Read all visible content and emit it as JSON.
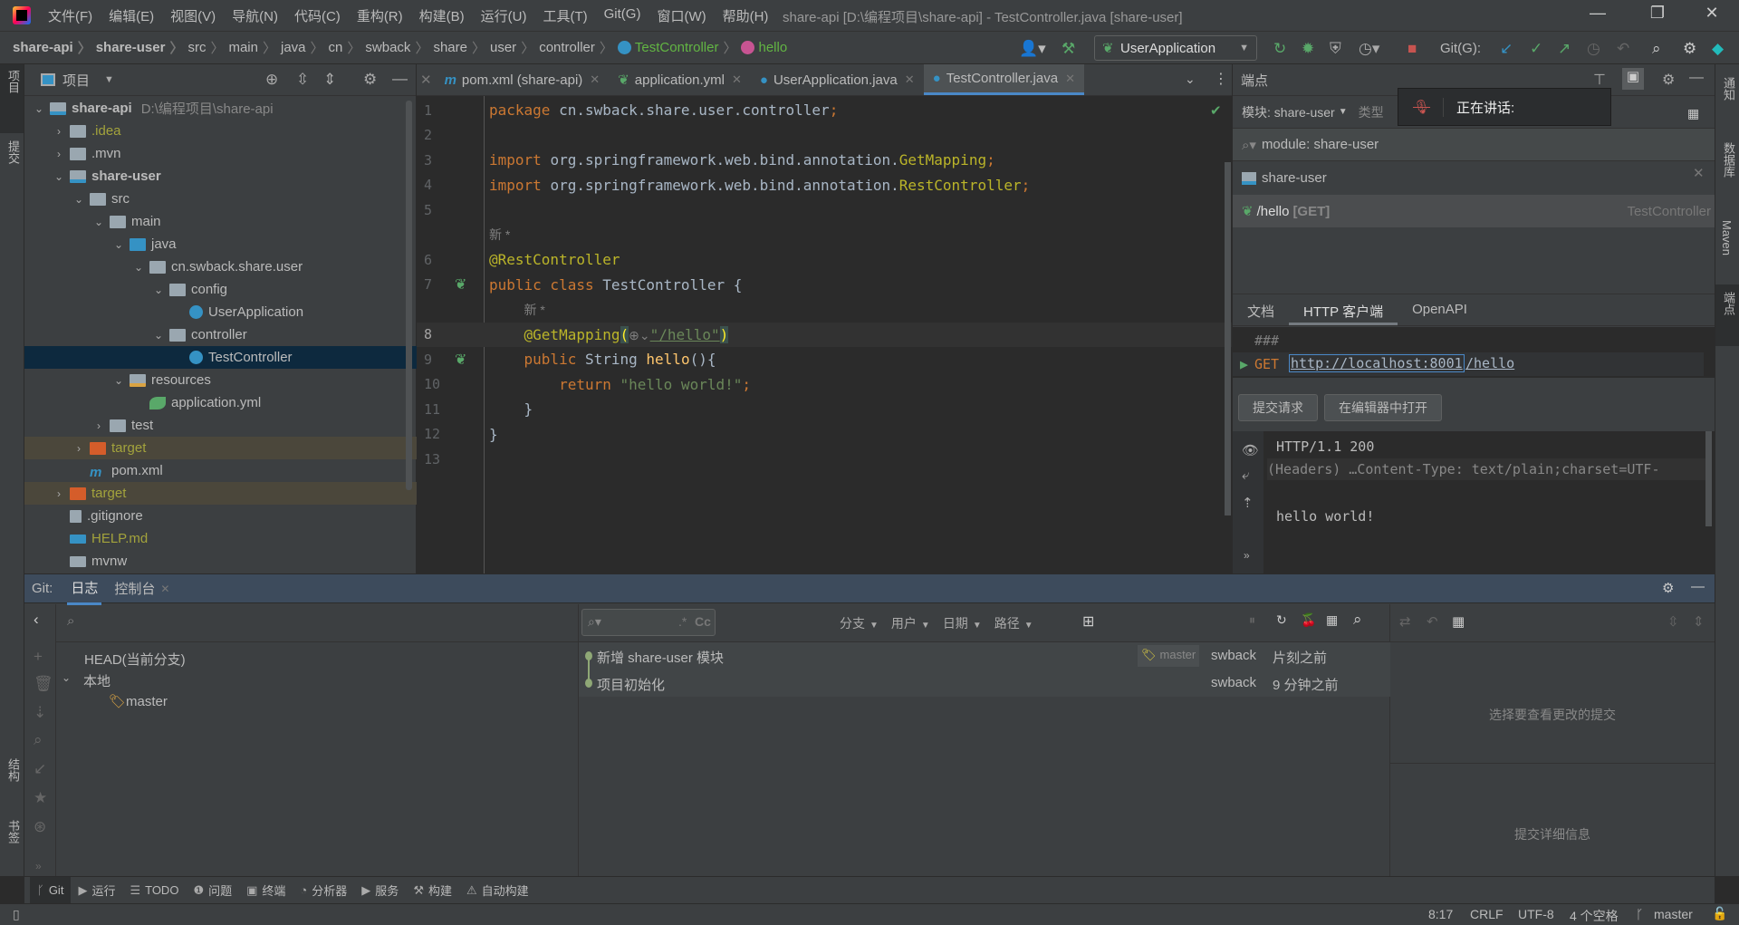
{
  "window": {
    "title": "share-api [D:\\编程项目\\share-api] - TestController.java [share-user]",
    "minimize": "—",
    "maximize": "❐",
    "close": "✕"
  },
  "menu": [
    "文件(F)",
    "编辑(E)",
    "视图(V)",
    "导航(N)",
    "代码(C)",
    "重构(R)",
    "构建(B)",
    "运行(U)",
    "工具(T)",
    "Git(G)",
    "窗口(W)",
    "帮助(H)"
  ],
  "breadcrumb": [
    "share-api",
    "share-user",
    "src",
    "main",
    "java",
    "cn",
    "swback",
    "share",
    "user",
    "controller",
    "TestController",
    "hello"
  ],
  "toolbar": {
    "run_config": "UserApplication",
    "git_label": "Git(G):"
  },
  "left_stripe": [
    "项目",
    "提交",
    "结构",
    "书签"
  ],
  "right_stripe": [
    "通知",
    "数据库",
    "Maven",
    "端点"
  ],
  "project": {
    "header": "项目",
    "root_path": "D:\\编程项目\\share-api",
    "tree": [
      {
        "label": "share-api",
        "depth": 0,
        "arrow": "open",
        "icon": "module",
        "bold": true
      },
      {
        "label": ".idea",
        "depth": 1,
        "arrow": "closed",
        "icon": "folder",
        "color": "#a3a33c"
      },
      {
        "label": ".mvn",
        "depth": 1,
        "arrow": "closed",
        "icon": "folder"
      },
      {
        "label": "share-user",
        "depth": 1,
        "arrow": "open",
        "icon": "module",
        "bold": true
      },
      {
        "label": "src",
        "depth": 2,
        "arrow": "open",
        "icon": "folder"
      },
      {
        "label": "main",
        "depth": 3,
        "arrow": "open",
        "icon": "folder"
      },
      {
        "label": "java",
        "depth": 4,
        "arrow": "open",
        "icon": "source-folder"
      },
      {
        "label": "cn.swback.share.user",
        "depth": 5,
        "arrow": "open",
        "icon": "package"
      },
      {
        "label": "config",
        "depth": 6,
        "arrow": "open",
        "icon": "package"
      },
      {
        "label": "UserApplication",
        "depth": 7,
        "arrow": "none",
        "icon": "spring-class"
      },
      {
        "label": "controller",
        "depth": 6,
        "arrow": "open",
        "icon": "package"
      },
      {
        "label": "TestController",
        "depth": 7,
        "arrow": "none",
        "icon": "class",
        "selected": true
      },
      {
        "label": "resources",
        "depth": 4,
        "arrow": "open",
        "icon": "resources-folder"
      },
      {
        "label": "application.yml",
        "depth": 5,
        "arrow": "none",
        "icon": "spring-yml"
      },
      {
        "label": "test",
        "depth": 3,
        "arrow": "closed",
        "icon": "folder"
      },
      {
        "label": "target",
        "depth": 2,
        "arrow": "closed",
        "icon": "excluded-folder",
        "color": "#a3a33c",
        "ignored": true
      },
      {
        "label": "pom.xml",
        "depth": 2,
        "arrow": "none",
        "icon": "maven"
      },
      {
        "label": "target",
        "depth": 1,
        "arrow": "closed",
        "icon": "excluded-folder",
        "color": "#a3a33c",
        "ignored": true
      },
      {
        "label": ".gitignore",
        "depth": 1,
        "arrow": "none",
        "icon": "file"
      },
      {
        "label": "HELP.md",
        "depth": 1,
        "arrow": "none",
        "icon": "markdown",
        "color": "#a3a33c"
      },
      {
        "label": "mvnw",
        "depth": 1,
        "arrow": "none",
        "icon": "script"
      }
    ]
  },
  "editor": {
    "tabs": [
      {
        "label": "pom.xml (share-api)",
        "icon": "maven"
      },
      {
        "label": "application.yml",
        "icon": "spring-yml"
      },
      {
        "label": "UserApplication.java",
        "icon": "spring-class"
      },
      {
        "label": "TestController.java",
        "icon": "class",
        "active": true
      }
    ],
    "lines": [
      {
        "n": "1",
        "t": [
          [
            "package ",
            "k"
          ],
          [
            "cn.swback.share.user.controller",
            "p"
          ],
          [
            ";",
            "k"
          ]
        ]
      },
      {
        "n": "2",
        "t": []
      },
      {
        "n": "3",
        "t": [
          [
            "import ",
            "k"
          ],
          [
            "org.springframework.web.bind.annotation.",
            "p"
          ],
          [
            "GetMapping",
            "a"
          ],
          [
            ";",
            "k"
          ]
        ]
      },
      {
        "n": "4",
        "t": [
          [
            "import ",
            "k"
          ],
          [
            "org.springframework.web.bind.annotation.",
            "p"
          ],
          [
            "RestController",
            "a"
          ],
          [
            ";",
            "k"
          ]
        ]
      },
      {
        "n": "5",
        "t": []
      },
      {
        "n": "",
        "t": [
          [
            "新 *",
            "h"
          ]
        ]
      },
      {
        "n": "6",
        "t": [
          [
            "@RestController",
            "a"
          ]
        ]
      },
      {
        "n": "7",
        "t": [
          [
            "public class ",
            "k"
          ],
          [
            "TestController {",
            "p"
          ]
        ]
      },
      {
        "n": "",
        "t": [
          [
            "    ",
            "p"
          ],
          [
            "新 *",
            "h"
          ]
        ]
      },
      {
        "n": "8",
        "t": [
          [
            "    ",
            "p"
          ],
          [
            "@GetMapping",
            "a"
          ],
          [
            "(",
            "y"
          ],
          [
            "⊕⌄",
            "h"
          ],
          [
            "\"/hello\"",
            "s"
          ],
          [
            ")",
            "y"
          ]
        ],
        "current": true
      },
      {
        "n": "9",
        "t": [
          [
            "    ",
            "p"
          ],
          [
            "public ",
            "k"
          ],
          [
            "String ",
            "p"
          ],
          [
            "hello",
            "m"
          ],
          [
            "(){",
            "p"
          ]
        ]
      },
      {
        "n": "10",
        "t": [
          [
            "        ",
            "p"
          ],
          [
            "return ",
            "k"
          ],
          [
            "\"hello world!\"",
            "s"
          ],
          [
            ";",
            "k"
          ]
        ]
      },
      {
        "n": "11",
        "t": [
          [
            "    }",
            "p"
          ]
        ]
      },
      {
        "n": "12",
        "t": [
          [
            "}",
            "p"
          ]
        ]
      },
      {
        "n": "13",
        "t": []
      }
    ]
  },
  "endpoints": {
    "title": "端点",
    "module_filter": "模块: share-user",
    "type_filter": "类型",
    "search": "module: share-user",
    "group": "share-user",
    "items": [
      {
        "path": "/hello",
        "method": "[GET]",
        "controller": "TestController"
      }
    ],
    "tabs": [
      "文档",
      "HTTP 客户端",
      "OpenAPI"
    ],
    "active_tab": "HTTP 客户端",
    "request_sep": "###",
    "request_method": "GET",
    "request_url_host": "http://localhost:8001",
    "request_url_path": "/hello",
    "submit_button": "提交请求",
    "open_in_editor_button": "在编辑器中打开",
    "response": {
      "status": "HTTP/1.1 200",
      "headers": "(Headers) …Content-Type: text/plain;charset=UTF-",
      "body": "hello world!"
    }
  },
  "speaking_popup": {
    "label": "正在讲话:"
  },
  "git": {
    "label": "Git:",
    "tabs": [
      "日志",
      "控制台"
    ],
    "branches": {
      "head": "HEAD(当前分支)",
      "local": "本地",
      "items": [
        "master"
      ]
    },
    "filters": [
      "分支",
      "用户",
      "日期",
      "路径"
    ],
    "commits": [
      {
        "message": "新增 share-user 模块",
        "tag": "master",
        "author": "swback",
        "time": "片刻之前"
      },
      {
        "message": "项目初始化",
        "author": "swback",
        "time": "9 分钟之前"
      }
    ],
    "details_empty": "选择要查看更改的提交",
    "details_info": "提交详细信息"
  },
  "tool_windows": [
    {
      "label": "Git",
      "icon": "git-branch-icon",
      "glyph": "ᚴ",
      "active": true
    },
    {
      "label": "运行",
      "icon": "run-icon",
      "glyph": "▶"
    },
    {
      "label": "TODO",
      "icon": "todo-icon",
      "glyph": "☰"
    },
    {
      "label": "问题",
      "icon": "problems-icon",
      "glyph": "❶"
    },
    {
      "label": "终端",
      "icon": "terminal-icon",
      "glyph": "▣"
    },
    {
      "label": "分析器",
      "icon": "profiler-icon",
      "glyph": "◔"
    },
    {
      "label": "服务",
      "icon": "services-icon",
      "glyph": "▶"
    },
    {
      "label": "构建",
      "icon": "build-icon",
      "glyph": "⚒"
    },
    {
      "label": "自动构建",
      "icon": "auto-build-icon",
      "glyph": "⚠"
    }
  ],
  "status": {
    "position": "8:17",
    "line_sep": "CRLF",
    "encoding": "UTF-8",
    "indent": "4 个空格",
    "branch": "master"
  },
  "colors": {
    "accent": "#4a88c7",
    "selection": "#0d293e",
    "keyword": "#cc7832",
    "string": "#6a8759",
    "annotation": "#bbb529"
  }
}
